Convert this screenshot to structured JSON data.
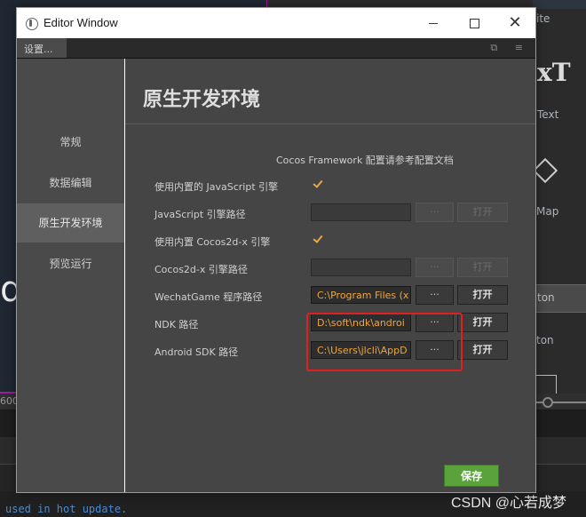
{
  "background": {
    "big_letter": "d",
    "right_panel": {
      "text_1": "ite",
      "logo_text": "xT",
      "text_2": "Text",
      "text_3": "Map",
      "button_label": "ton",
      "text_4": "ton"
    },
    "timeline_label": "600",
    "console_text": "used in hot update.",
    "watermark": "CSDN @心若成梦"
  },
  "window": {
    "title": "Editor Window",
    "tab_label": "设置...",
    "tab_icons": "⧉ ≡",
    "sidebar": [
      {
        "label": "常规",
        "active": false
      },
      {
        "label": "数据编辑",
        "active": false
      },
      {
        "label": "原生开发环境",
        "active": true
      },
      {
        "label": "预览运行",
        "active": false
      }
    ],
    "heading": "原生开发环境",
    "doc_link": "Cocos Framework 配置请参考配置文档",
    "rows": [
      {
        "label": "使用内置的 JavaScript 引擎",
        "type": "checkbox",
        "checked": true
      },
      {
        "label": "JavaScript 引擎路径",
        "type": "path",
        "value": "",
        "enabled": false,
        "dots": "···",
        "open": "打开"
      },
      {
        "label": "使用内置 Cocos2d-x 引擎",
        "type": "checkbox",
        "checked": true
      },
      {
        "label": "Cocos2d-x 引擎路径",
        "type": "path",
        "value": "",
        "enabled": false,
        "dots": "···",
        "open": "打开"
      },
      {
        "label": "WechatGame 程序路径",
        "type": "path",
        "value": "C:\\Program Files (x",
        "enabled": true,
        "dots": "···",
        "open": "打开"
      },
      {
        "label": "NDK 路径",
        "type": "path",
        "value": "D:\\soft\\ndk\\androi",
        "enabled": true,
        "dots": "···",
        "open": "打开"
      },
      {
        "label": "Android SDK 路径",
        "type": "path",
        "value": "C:\\Users\\jlcli\\AppD",
        "enabled": true,
        "dots": "···",
        "open": "打开"
      }
    ],
    "save_label": "保存",
    "accent_color": "#f0a63a",
    "highlight_color": "#e02020",
    "save_color": "#5aa33b"
  }
}
